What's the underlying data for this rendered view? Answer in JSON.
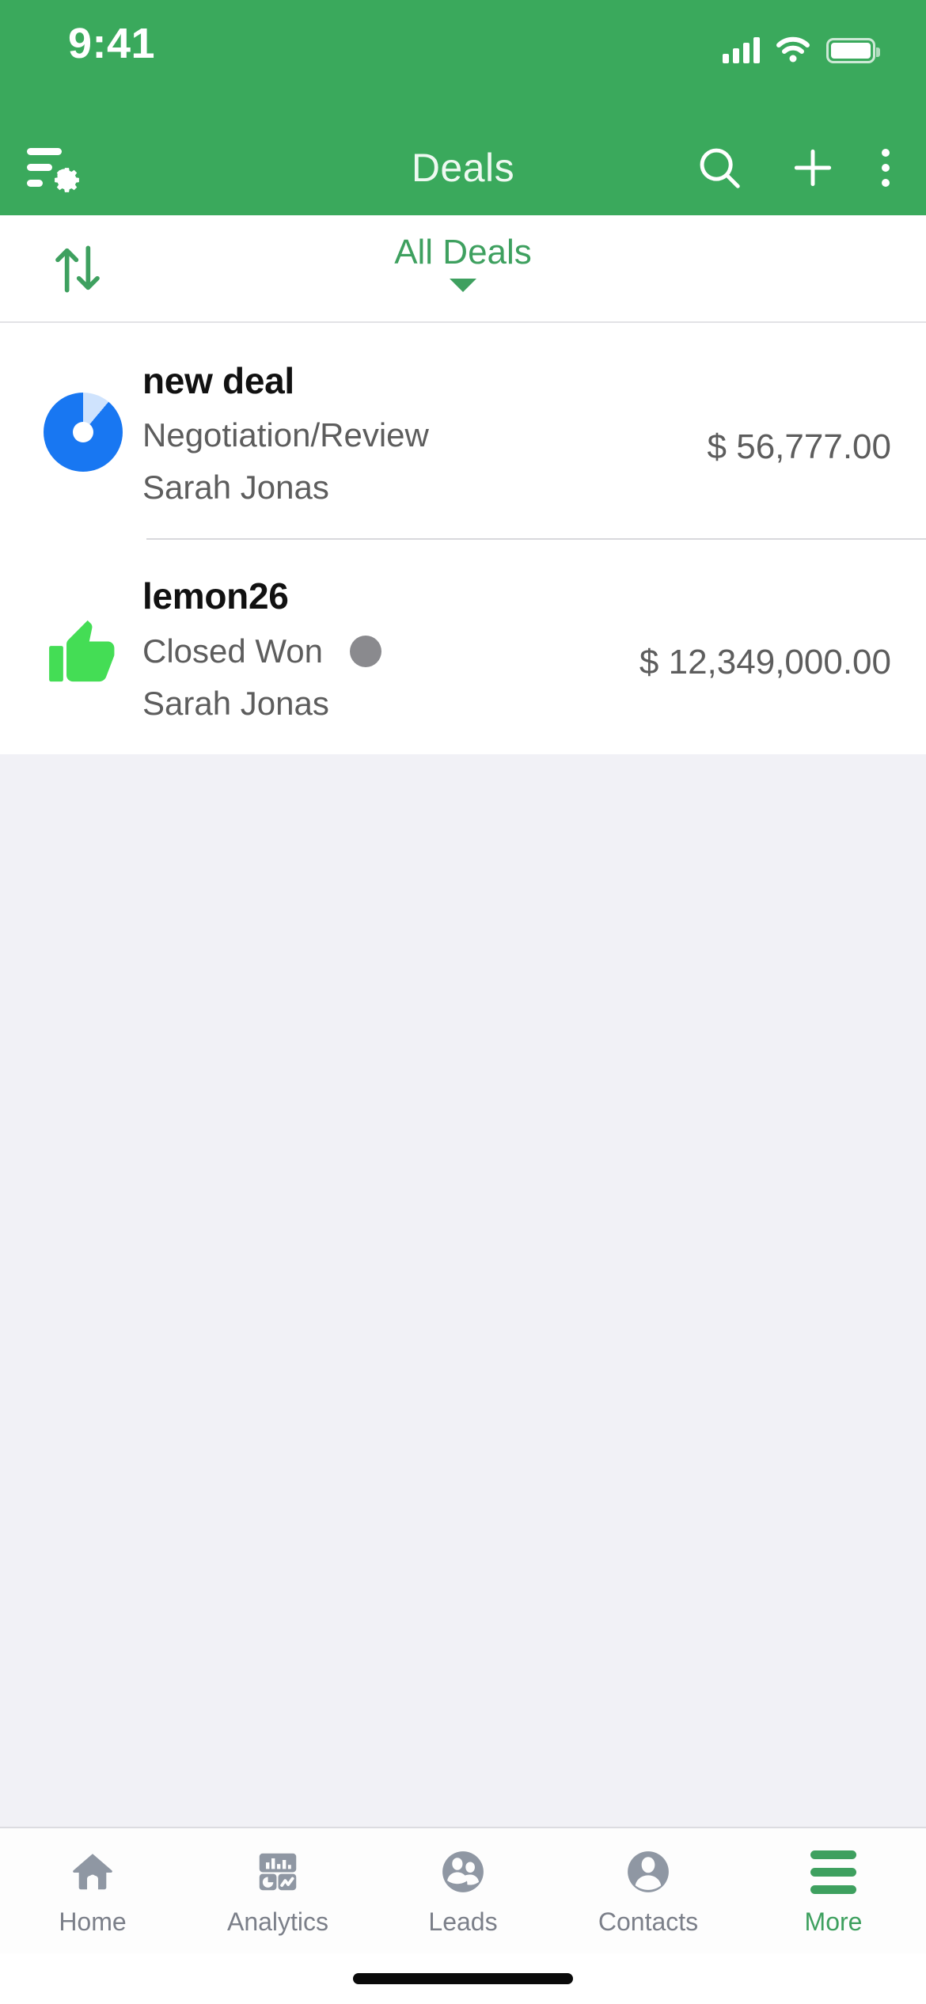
{
  "status_bar": {
    "time": "9:41",
    "signal_icon": "cellular-signal-icon",
    "wifi_icon": "wifi-icon",
    "battery_icon": "battery-icon"
  },
  "app_bar": {
    "title": "Deals",
    "left_icon": "filter-settings-icon",
    "actions": [
      {
        "name": "search-icon",
        "label": "Search"
      },
      {
        "name": "add-icon",
        "label": "Add"
      },
      {
        "name": "overflow-menu-icon",
        "label": "More options"
      }
    ]
  },
  "filter_bar": {
    "sort_icon": "sort-arrows-icon",
    "view_label": "All Deals",
    "caret_icon": "chevron-down-icon"
  },
  "deals": [
    {
      "title": "new deal",
      "stage": "Negotiation/Review",
      "owner": "Sarah Jonas",
      "amount": "$ 56,777.00",
      "icon": "pie-progress-icon",
      "has_stage_dot": false
    },
    {
      "title": "lemon26",
      "stage": "Closed Won",
      "owner": "Sarah Jonas",
      "amount": "$ 12,349,000.00",
      "icon": "thumbs-up-icon",
      "has_stage_dot": true
    }
  ],
  "tab_bar": {
    "tabs": [
      {
        "label": "Home",
        "icon": "home-icon",
        "active": false
      },
      {
        "label": "Analytics",
        "icon": "analytics-icon",
        "active": false
      },
      {
        "label": "Leads",
        "icon": "leads-icon",
        "active": false
      },
      {
        "label": "Contacts",
        "icon": "contacts-icon",
        "active": false
      },
      {
        "label": "More",
        "icon": "hamburger-icon",
        "active": true
      }
    ]
  },
  "colors": {
    "brand_green": "#3aa95c",
    "accent_green": "#3ea05f",
    "blue": "#1877f2",
    "thumb_green": "#44dd55",
    "gray_icon": "#8f97a3",
    "background": "#f1f1f6"
  }
}
